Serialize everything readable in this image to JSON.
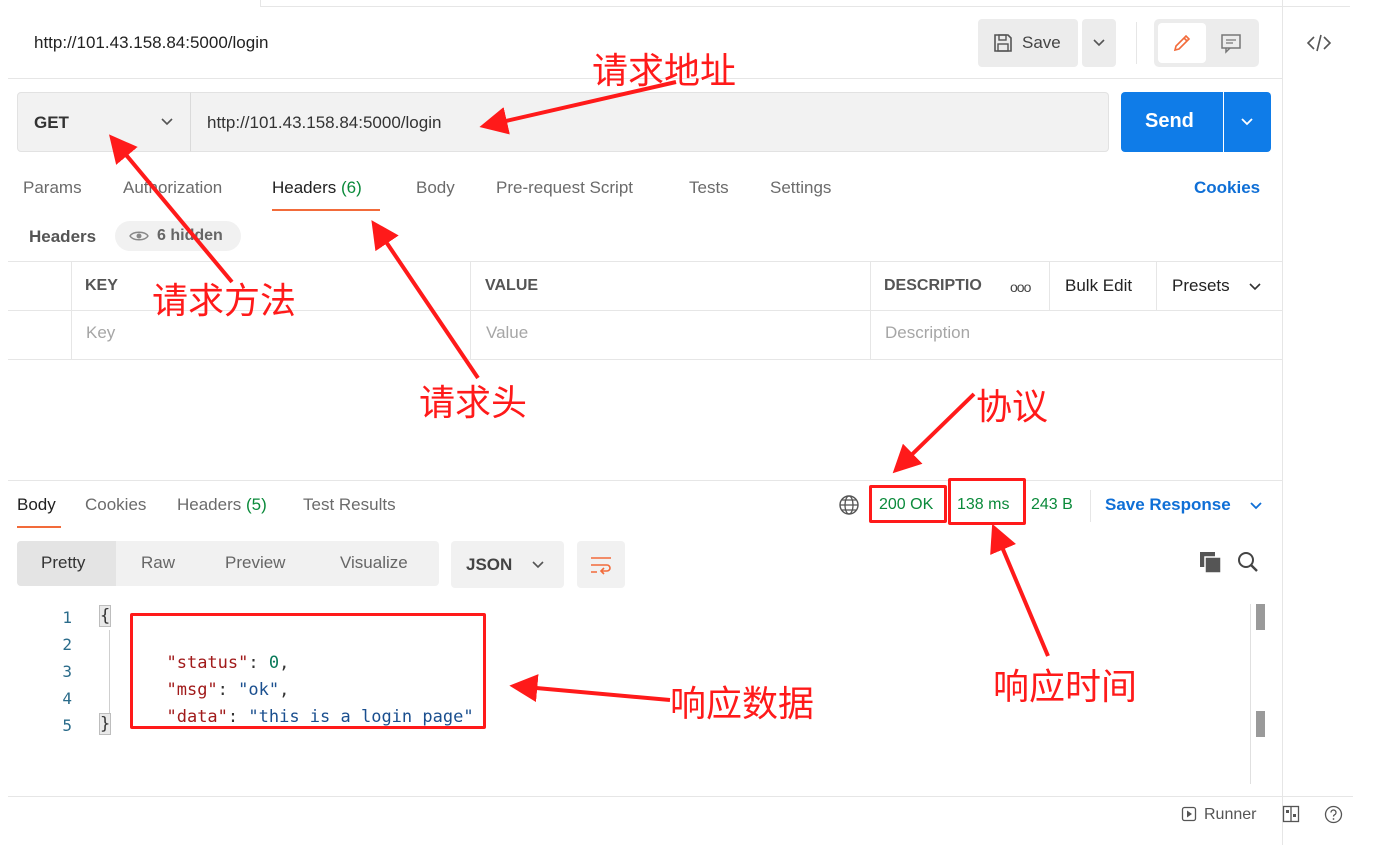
{
  "request": {
    "title": "http://101.43.158.84:5000/login",
    "save_label": "Save",
    "method": "GET",
    "url": "http://101.43.158.84:5000/login",
    "send_label": "Send"
  },
  "request_tabs": {
    "params": "Params",
    "authorization": "Authorization",
    "headers_label": "Headers",
    "headers_count": "(6)",
    "body": "Body",
    "prerequest": "Pre-request Script",
    "tests": "Tests",
    "settings": "Settings",
    "cookies": "Cookies"
  },
  "headers_section": {
    "title": "Headers",
    "hidden": "6 hidden",
    "columns": {
      "key": "KEY",
      "value": "VALUE",
      "description": "DESCRIPTIO"
    },
    "more": "ooo",
    "bulk_edit": "Bulk Edit",
    "presets": "Presets",
    "placeholders": {
      "key": "Key",
      "value": "Value",
      "description": "Description"
    }
  },
  "response_tabs": {
    "body": "Body",
    "cookies": "Cookies",
    "headers_label": "Headers",
    "headers_count": "(5)",
    "test_results": "Test Results"
  },
  "response_status": {
    "status": "200 OK",
    "time": "138 ms",
    "size": "243 B",
    "save_response": "Save Response"
  },
  "response_view": {
    "modes": [
      "Pretty",
      "Raw",
      "Preview",
      "Visualize"
    ],
    "format": "JSON"
  },
  "response_code": {
    "line_numbers": [
      "1",
      "2",
      "3",
      "4",
      "5"
    ],
    "open_brace": "{",
    "close_brace": "}",
    "lines": [
      {
        "key": "\"status\"",
        "colon": ": ",
        "value": "0",
        "comma": ","
      },
      {
        "key": "\"msg\"",
        "colon": ": ",
        "value": "\"ok\"",
        "comma": ","
      },
      {
        "key": "\"data\"",
        "colon": ": ",
        "value": "\"this is a login page\"",
        "comma": ""
      }
    ]
  },
  "footer": {
    "runner": "Runner"
  },
  "annotations": {
    "address": "请求地址",
    "method": "请求方法",
    "headers": "请求头",
    "protocol": "协议",
    "time": "响应时间",
    "data": "响应数据"
  },
  "colors": {
    "accent_blue": "#0f7ce8",
    "active_tab": "#f26b3a",
    "status_green": "#0a8a3a",
    "annotation_red": "#ff1a1a"
  },
  "icons": [
    "floppy-icon",
    "chevron-down-icon",
    "pencil-icon",
    "comment-icon",
    "code-icon",
    "eye-icon",
    "globe-icon",
    "wrap-icon",
    "copy-icon",
    "search-icon",
    "runner-icon",
    "layout-icon",
    "help-icon"
  ]
}
